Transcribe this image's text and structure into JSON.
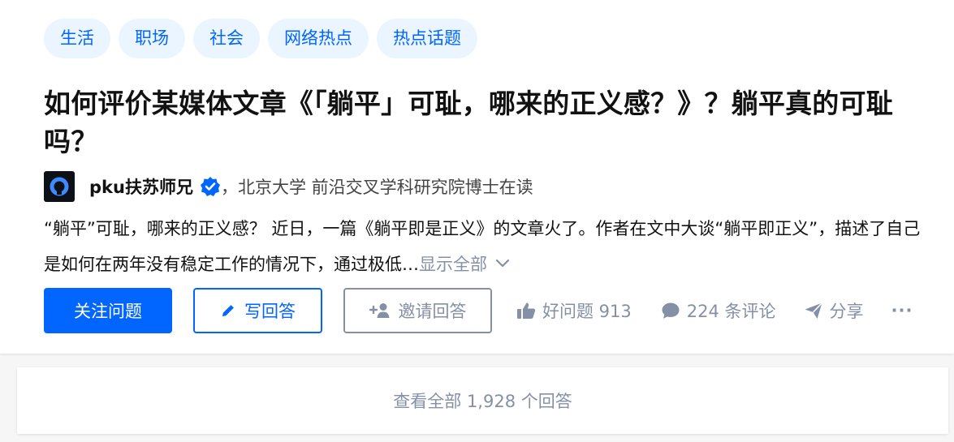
{
  "topics": [
    "生活",
    "职场",
    "社会",
    "网络热点",
    "热点话题"
  ],
  "question": {
    "title": "如何评价某媒体文章《「躺平」可耻，哪来的正义感？》？躺平真的可耻吗？"
  },
  "author": {
    "name": "pku扶苏师兄",
    "description": "，北京大学 前沿交叉学科研究院博士在读",
    "verified_icon": "verified-badge-icon",
    "avatar_icon": "avatar-icon"
  },
  "excerpt": {
    "text": "“躺平”可耻，哪来的正义感？ 近日，一篇《躺平即是正义》的文章火了。作者在文中大谈“躺平即正义”，描述了自己是如何在两年没有稳定工作的情况下，通过极低…",
    "show_all_label": "显示全部"
  },
  "actions": {
    "follow_label": "关注问题",
    "write_label": "写回答",
    "invite_label": "邀请回答",
    "like_label": "好问题 913",
    "comment_label": "224 条评论",
    "share_label": "分享",
    "more_label": "···"
  },
  "answers": {
    "view_all_label": "查看全部 1,928 个回答"
  },
  "colors": {
    "accent": "#0066ff",
    "tag_background": "#ebf5ff",
    "muted": "#8590a6",
    "text": "#121212"
  }
}
